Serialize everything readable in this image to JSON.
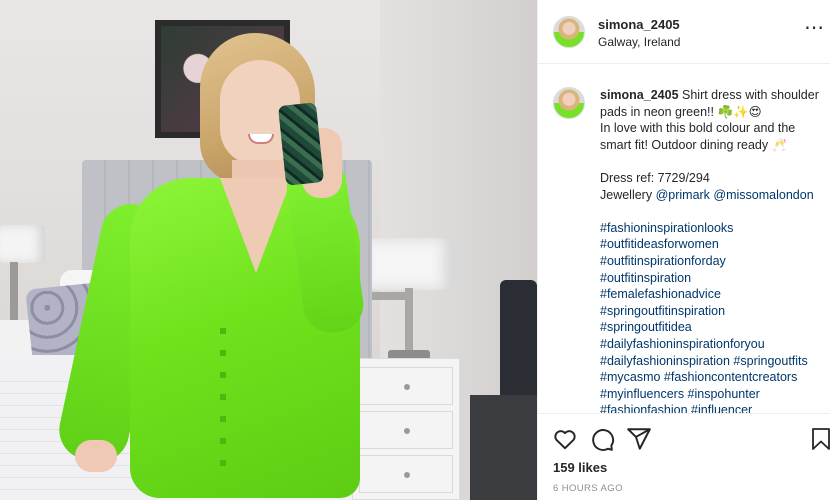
{
  "post": {
    "username": "simona_2405",
    "location": "Galway, Ireland",
    "more_icon": "more-horizontal-icon"
  },
  "caption": {
    "username": "simona_2405",
    "line1": " Shirt dress with shoulder",
    "line2": "pads in neon green!! ☘️✨😍",
    "line3": "In love with this bold colour and the",
    "line4": "smart fit! Outdoor dining ready 🥂",
    "dress_ref": "Dress ref: 7729/294",
    "jewellery_label": "Jewellery ",
    "mention1": "@primark",
    "mention2": "@missomalondon",
    "hashtags": [
      "#fashioninspirationlooks",
      "#outfitideasforwomen",
      "#outfitinspirationforday",
      "#outfitinspiration",
      "#femalefashionadvice",
      "#springoutfitinspiration",
      "#springoutfitidea",
      "#dailyfashioninspirationforyou",
      "#dailyfashioninspiration #springoutfits",
      "#mycasmo #fashioncontentcreators",
      "#myinfluencers #inspohunter",
      "#fashionfashion #influencer"
    ]
  },
  "actions": {
    "likes": "159 likes",
    "timestamp": "6 HOURS AGO"
  },
  "colors": {
    "accent_link": "#00376b",
    "dress_green": "#6fe21c"
  }
}
